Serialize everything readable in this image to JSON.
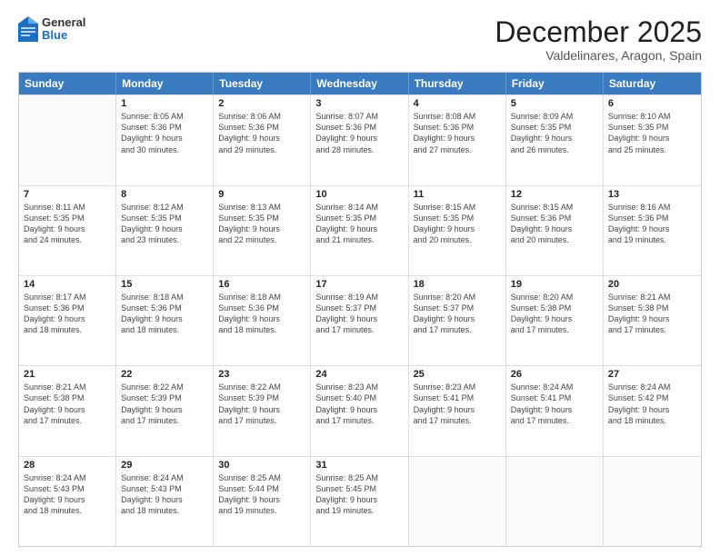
{
  "header": {
    "logo": {
      "general": "General",
      "blue": "Blue"
    },
    "title": "December 2025",
    "subtitle": "Valdelinares, Aragon, Spain"
  },
  "weekdays": [
    "Sunday",
    "Monday",
    "Tuesday",
    "Wednesday",
    "Thursday",
    "Friday",
    "Saturday"
  ],
  "rows": [
    [
      {
        "day": "",
        "info": ""
      },
      {
        "day": "1",
        "info": "Sunrise: 8:05 AM\nSunset: 5:36 PM\nDaylight: 9 hours\nand 30 minutes."
      },
      {
        "day": "2",
        "info": "Sunrise: 8:06 AM\nSunset: 5:36 PM\nDaylight: 9 hours\nand 29 minutes."
      },
      {
        "day": "3",
        "info": "Sunrise: 8:07 AM\nSunset: 5:36 PM\nDaylight: 9 hours\nand 28 minutes."
      },
      {
        "day": "4",
        "info": "Sunrise: 8:08 AM\nSunset: 5:36 PM\nDaylight: 9 hours\nand 27 minutes."
      },
      {
        "day": "5",
        "info": "Sunrise: 8:09 AM\nSunset: 5:35 PM\nDaylight: 9 hours\nand 26 minutes."
      },
      {
        "day": "6",
        "info": "Sunrise: 8:10 AM\nSunset: 5:35 PM\nDaylight: 9 hours\nand 25 minutes."
      }
    ],
    [
      {
        "day": "7",
        "info": "Sunrise: 8:11 AM\nSunset: 5:35 PM\nDaylight: 9 hours\nand 24 minutes."
      },
      {
        "day": "8",
        "info": "Sunrise: 8:12 AM\nSunset: 5:35 PM\nDaylight: 9 hours\nand 23 minutes."
      },
      {
        "day": "9",
        "info": "Sunrise: 8:13 AM\nSunset: 5:35 PM\nDaylight: 9 hours\nand 22 minutes."
      },
      {
        "day": "10",
        "info": "Sunrise: 8:14 AM\nSunset: 5:35 PM\nDaylight: 9 hours\nand 21 minutes."
      },
      {
        "day": "11",
        "info": "Sunrise: 8:15 AM\nSunset: 5:35 PM\nDaylight: 9 hours\nand 20 minutes."
      },
      {
        "day": "12",
        "info": "Sunrise: 8:15 AM\nSunset: 5:36 PM\nDaylight: 9 hours\nand 20 minutes."
      },
      {
        "day": "13",
        "info": "Sunrise: 8:16 AM\nSunset: 5:36 PM\nDaylight: 9 hours\nand 19 minutes."
      }
    ],
    [
      {
        "day": "14",
        "info": "Sunrise: 8:17 AM\nSunset: 5:36 PM\nDaylight: 9 hours\nand 18 minutes."
      },
      {
        "day": "15",
        "info": "Sunrise: 8:18 AM\nSunset: 5:36 PM\nDaylight: 9 hours\nand 18 minutes."
      },
      {
        "day": "16",
        "info": "Sunrise: 8:18 AM\nSunset: 5:36 PM\nDaylight: 9 hours\nand 18 minutes."
      },
      {
        "day": "17",
        "info": "Sunrise: 8:19 AM\nSunset: 5:37 PM\nDaylight: 9 hours\nand 17 minutes."
      },
      {
        "day": "18",
        "info": "Sunrise: 8:20 AM\nSunset: 5:37 PM\nDaylight: 9 hours\nand 17 minutes."
      },
      {
        "day": "19",
        "info": "Sunrise: 8:20 AM\nSunset: 5:38 PM\nDaylight: 9 hours\nand 17 minutes."
      },
      {
        "day": "20",
        "info": "Sunrise: 8:21 AM\nSunset: 5:38 PM\nDaylight: 9 hours\nand 17 minutes."
      }
    ],
    [
      {
        "day": "21",
        "info": "Sunrise: 8:21 AM\nSunset: 5:38 PM\nDaylight: 9 hours\nand 17 minutes."
      },
      {
        "day": "22",
        "info": "Sunrise: 8:22 AM\nSunset: 5:39 PM\nDaylight: 9 hours\nand 17 minutes."
      },
      {
        "day": "23",
        "info": "Sunrise: 8:22 AM\nSunset: 5:39 PM\nDaylight: 9 hours\nand 17 minutes."
      },
      {
        "day": "24",
        "info": "Sunrise: 8:23 AM\nSunset: 5:40 PM\nDaylight: 9 hours\nand 17 minutes."
      },
      {
        "day": "25",
        "info": "Sunrise: 8:23 AM\nSunset: 5:41 PM\nDaylight: 9 hours\nand 17 minutes."
      },
      {
        "day": "26",
        "info": "Sunrise: 8:24 AM\nSunset: 5:41 PM\nDaylight: 9 hours\nand 17 minutes."
      },
      {
        "day": "27",
        "info": "Sunrise: 8:24 AM\nSunset: 5:42 PM\nDaylight: 9 hours\nand 18 minutes."
      }
    ],
    [
      {
        "day": "28",
        "info": "Sunrise: 8:24 AM\nSunset: 5:43 PM\nDaylight: 9 hours\nand 18 minutes."
      },
      {
        "day": "29",
        "info": "Sunrise: 8:24 AM\nSunset: 5:43 PM\nDaylight: 9 hours\nand 18 minutes."
      },
      {
        "day": "30",
        "info": "Sunrise: 8:25 AM\nSunset: 5:44 PM\nDaylight: 9 hours\nand 19 minutes."
      },
      {
        "day": "31",
        "info": "Sunrise: 8:25 AM\nSunset: 5:45 PM\nDaylight: 9 hours\nand 19 minutes."
      },
      {
        "day": "",
        "info": ""
      },
      {
        "day": "",
        "info": ""
      },
      {
        "day": "",
        "info": ""
      }
    ]
  ]
}
